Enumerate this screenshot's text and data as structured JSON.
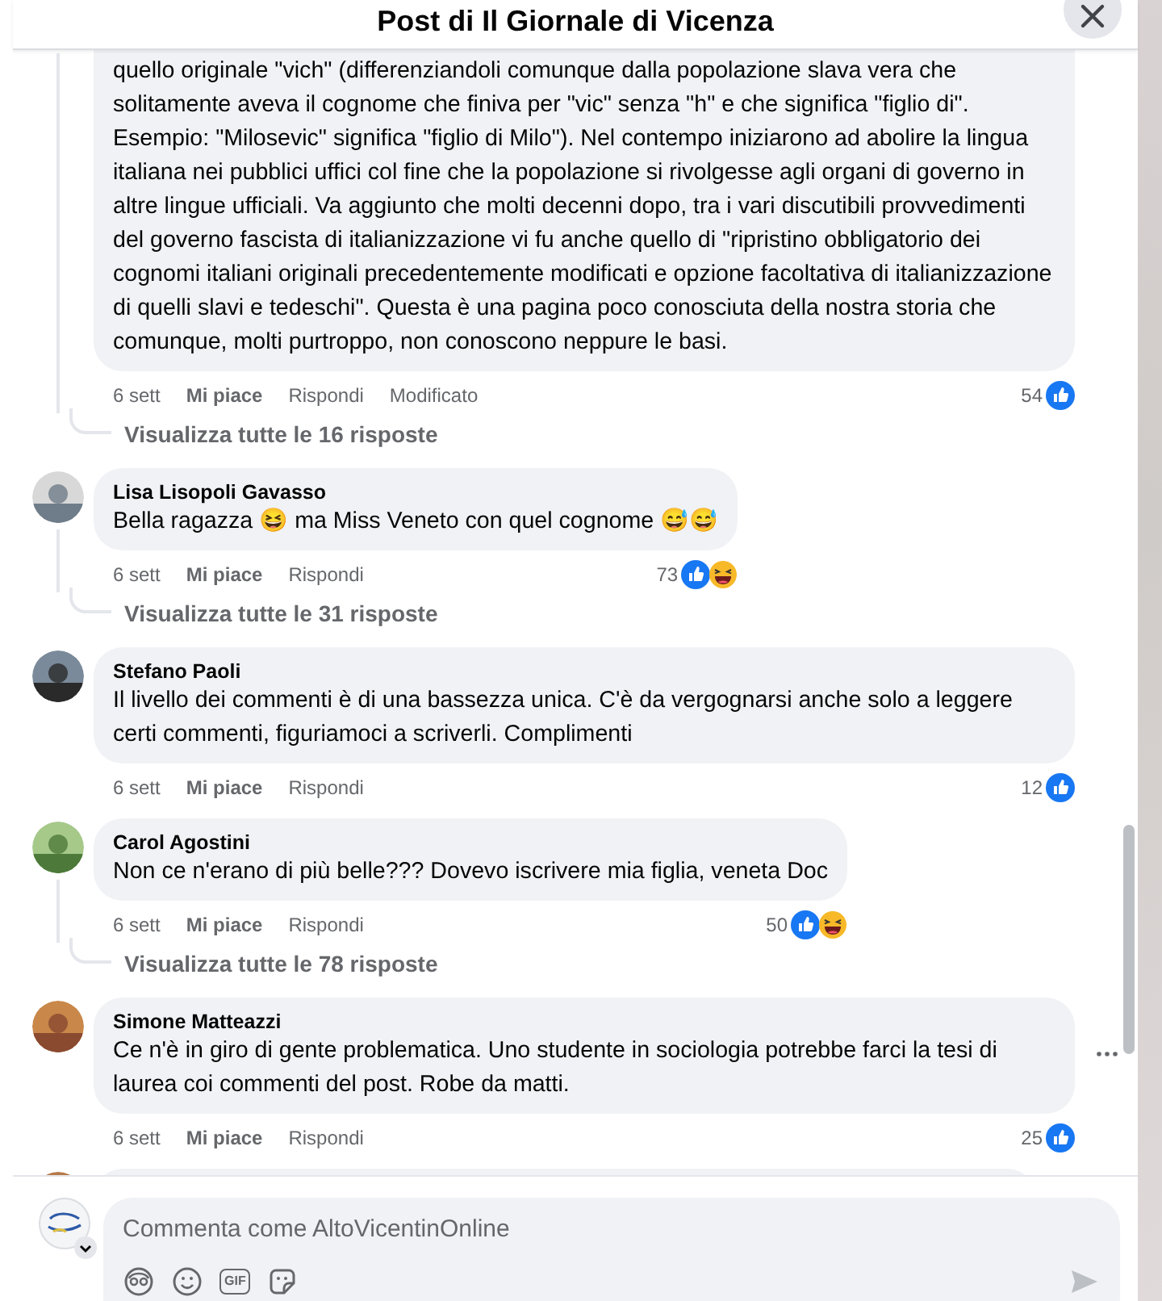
{
  "dialog": {
    "title": "Post di Il Giornale di Vicenza"
  },
  "comments": [
    {
      "text": "quello originale \"vich\" (differenziandoli comunque dalla popolazione slava vera che solitamente aveva il cognome che finiva per \"vic\" senza \"h\" e che significa \"figlio di\". Esempio: \"Milosevic\" significa \"figlio di Milo\"). Nel contempo iniziarono ad abolire la lingua italiana nei pubblici uffici col fine che la popolazione si rivolgesse agli organi di governo in altre lingue ufficiali. Va aggiunto che molti decenni dopo, tra i vari discutibili provvedimenti del governo fascista di italianizzazione vi fu anche quello di \"ripristino obbligatorio dei cognomi italiani originali precedentemente modificati e opzione facoltativa di italianizzazione di quelli slavi e tedeschi\". Questa è una pagina poco conosciuta della nostra storia che comunque, molti purtroppo, non conoscono neppure le basi.",
      "time": "6 sett",
      "like": "Mi piace",
      "reply": "Rispondi",
      "edited": "Modificato",
      "reaction_count": "54",
      "reactions": [
        {
          "kind": "like"
        }
      ],
      "hovered": false,
      "replies_link": "Visualizza tutte le 16 risposte"
    },
    {
      "author": "Lisa Lisopoli Gavasso",
      "text": "Bella ragazza 😆 ma Miss Veneto con quel cognome 😅😅",
      "time": "6 sett",
      "like": "Mi piace",
      "reply": "Rispondi",
      "reaction_count": "73",
      "reactions": [
        {
          "kind": "like"
        },
        {
          "kind": "haha"
        }
      ],
      "hovered": false,
      "replies_link": "Visualizza tutte le 31 risposte"
    },
    {
      "author": "Stefano Paoli",
      "text": "Il livello dei commenti è di una bassezza unica. C'è da vergognarsi anche solo a leggere certi commenti, figuriamoci a scriverli. Complimenti",
      "time": "6 sett",
      "like": "Mi piace",
      "reply": "Rispondi",
      "reaction_count": "12",
      "reactions": [
        {
          "kind": "like"
        }
      ],
      "hovered": false
    },
    {
      "author": "Carol Agostini",
      "text": "Non ce n'erano di più belle??? Dovevo iscrivere mia figlia, veneta Doc",
      "time": "6 sett",
      "like": "Mi piace",
      "reply": "Rispondi",
      "reaction_count": "50",
      "reactions": [
        {
          "kind": "like"
        },
        {
          "kind": "haha"
        }
      ],
      "hovered": false,
      "replies_link": "Visualizza tutte le 78 risposte"
    },
    {
      "author": "Simone Matteazzi",
      "text": "Ce n'è in giro di gente problematica. Uno studente in sociologia potrebbe farci la tesi di laurea coi commenti del post. Robe da matti.",
      "time": "6 sett",
      "like": "Mi piace",
      "reply": "Rispondi",
      "reaction_count": "25",
      "reactions": [
        {
          "kind": "like"
        }
      ],
      "hovered": true
    }
  ],
  "composer": {
    "placeholder": "Commenta come AltoVicentinOnline",
    "tools": [
      {
        "kind": "avatar"
      },
      {
        "kind": "emoji"
      },
      {
        "kind": "gif",
        "label": "GIF"
      },
      {
        "kind": "sticker"
      }
    ]
  }
}
